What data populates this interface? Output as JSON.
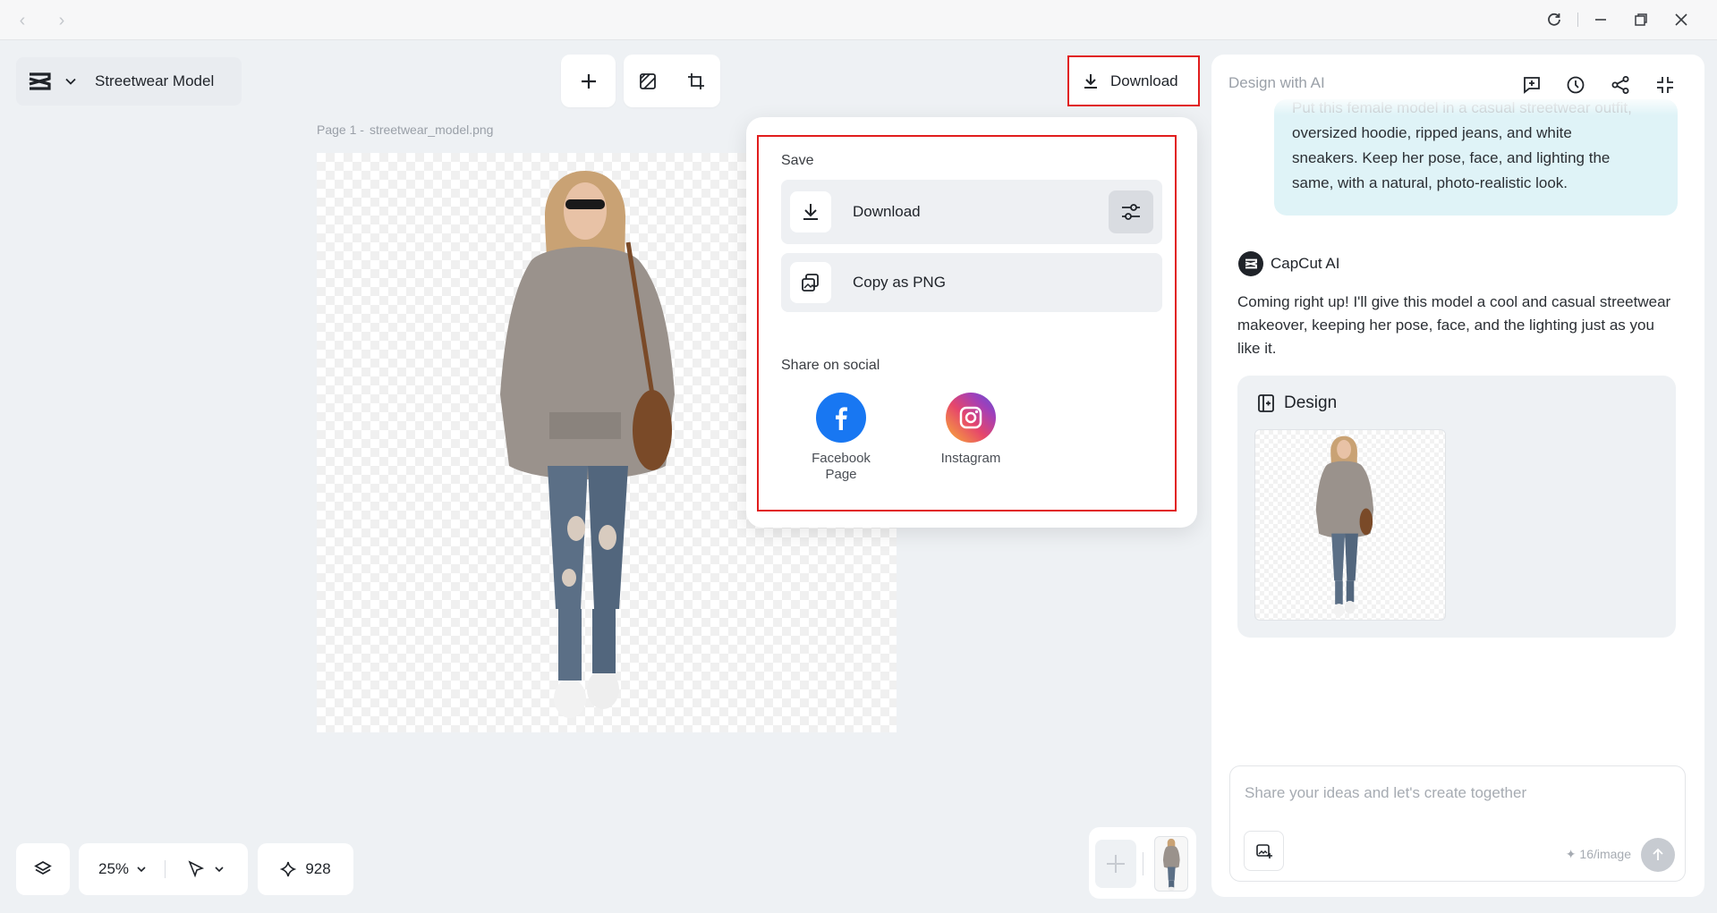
{
  "window": {
    "back_icon": "chevron-left",
    "forward_icon": "chevron-right",
    "controls": [
      "refresh",
      "minimize",
      "restore",
      "close"
    ]
  },
  "project": {
    "name": "Streetwear Model"
  },
  "toolbar": {
    "download_label": "Download"
  },
  "canvas": {
    "page_prefix": "Page 1 -",
    "file_name": "streetwear_model.png"
  },
  "popover": {
    "save_label": "Save",
    "download_label": "Download",
    "copy_label": "Copy as PNG",
    "share_label": "Share on social",
    "facebook_label_1": "Facebook",
    "facebook_label_2": "Page",
    "instagram_label": "Instagram"
  },
  "panel": {
    "title": "Design with AI",
    "user_message_faded": "Put this female model in a casual streetwear outfit,",
    "user_message_lines": [
      "oversized hoodie, ripped jeans, and white",
      "sneakers. Keep her pose, face, and lighting the",
      "same, with a natural, photo-realistic look."
    ],
    "ai_name": "CapCut AI",
    "ai_message": "Coming right up! I'll give this model a cool and casual streetwear makeover, keeping her pose, face, and the lighting just as you like it.",
    "design_label": "Design",
    "input_placeholder": "Share your ideas and let's create together",
    "cost_label": "16/image"
  },
  "bottom": {
    "zoom": "25%",
    "credits": "928"
  },
  "colors": {
    "highlight_border": "#e11d1d",
    "bubble_bg": "#dff3f7",
    "facebook": "#1877f2",
    "panel_bg": "#ffffff",
    "app_bg": "#eef1f4"
  }
}
